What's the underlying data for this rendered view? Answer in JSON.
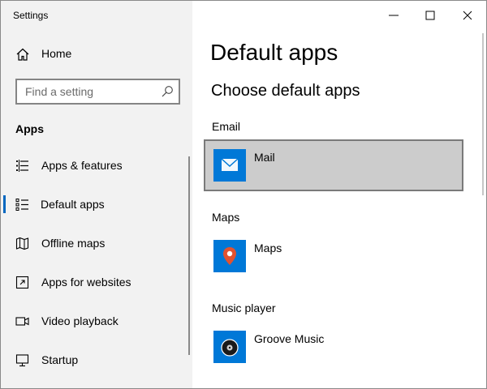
{
  "window": {
    "title": "Settings"
  },
  "sidebar": {
    "home_label": "Home",
    "search": {
      "placeholder": "Find a setting"
    },
    "section_title": "Apps",
    "items": [
      {
        "label": "Apps & features",
        "icon": "list-icon",
        "active": false
      },
      {
        "label": "Default apps",
        "icon": "default-apps-icon",
        "active": true
      },
      {
        "label": "Offline maps",
        "icon": "map-icon",
        "active": false
      },
      {
        "label": "Apps for websites",
        "icon": "open-in-icon",
        "active": false
      },
      {
        "label": "Video playback",
        "icon": "video-icon",
        "active": false
      },
      {
        "label": "Startup",
        "icon": "startup-icon",
        "active": false
      }
    ]
  },
  "main": {
    "title": "Default apps",
    "subtitle": "Choose default apps",
    "categories": [
      {
        "label": "Email",
        "app": "Mail",
        "selected": true
      },
      {
        "label": "Maps",
        "app": "Maps",
        "selected": false
      },
      {
        "label": "Music player",
        "app": "Groove Music",
        "selected": false
      }
    ]
  },
  "colors": {
    "accent": "#0067c0",
    "tile_blue": "#0078d7",
    "sidebar_bg": "#f2f2f2",
    "selected_bg": "#cccccc",
    "map_pin": "#e2522f"
  }
}
